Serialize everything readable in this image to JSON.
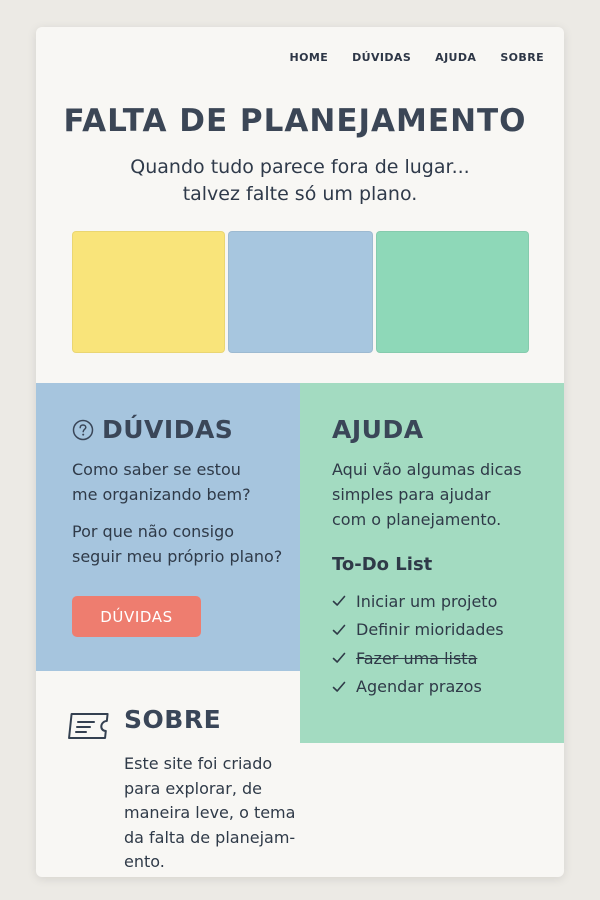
{
  "nav": {
    "items": [
      "HOME",
      "DÚVIDAS",
      "AJUDA",
      "SOBRE"
    ]
  },
  "hero": {
    "title": "FALTA DE PLANEJAMENTO",
    "subtitle_line1": "Quando tudo parece fora de lugar...",
    "subtitle_line2": "talvez falte só um plano."
  },
  "swatches": {
    "colors": [
      "#f9e47a",
      "#a7c6df",
      "#8ed8b8"
    ]
  },
  "duvidas": {
    "icon": "question-circle-icon",
    "title": "DÚVIDAS",
    "q1_line1": "Como saber se estou",
    "q1_line2": "me organizando bem?",
    "q2_line1": "Por que não consigo",
    "q2_line2": "seguir meu próprio plano?",
    "button_label": "DÚVIDAS",
    "panel_color": "#a6c5de",
    "button_color": "#ee7d6f"
  },
  "ajuda": {
    "title": "AJUDA",
    "text_line1": "Aqui vão algumas dicas",
    "text_line2": "simples para ajudar",
    "text_line3": "com o planejamento.",
    "panel_color": "#a3dbc1",
    "todo": {
      "title": "To-Do List",
      "items": [
        {
          "label": "Iniciar um projeto",
          "done": false
        },
        {
          "label": "Definir mioridades",
          "done": false
        },
        {
          "label": "Fazer uma lista",
          "done": true
        },
        {
          "label": "Agendar prazos",
          "done": false
        }
      ]
    }
  },
  "sobre": {
    "icon": "ticket-icon",
    "title": "SOBRE",
    "line1": "Este site foi criado",
    "line2": "para explorar, de",
    "line3": "maneira leve, o tema",
    "line4": "da falta de planejam-",
    "line5": "ento."
  }
}
